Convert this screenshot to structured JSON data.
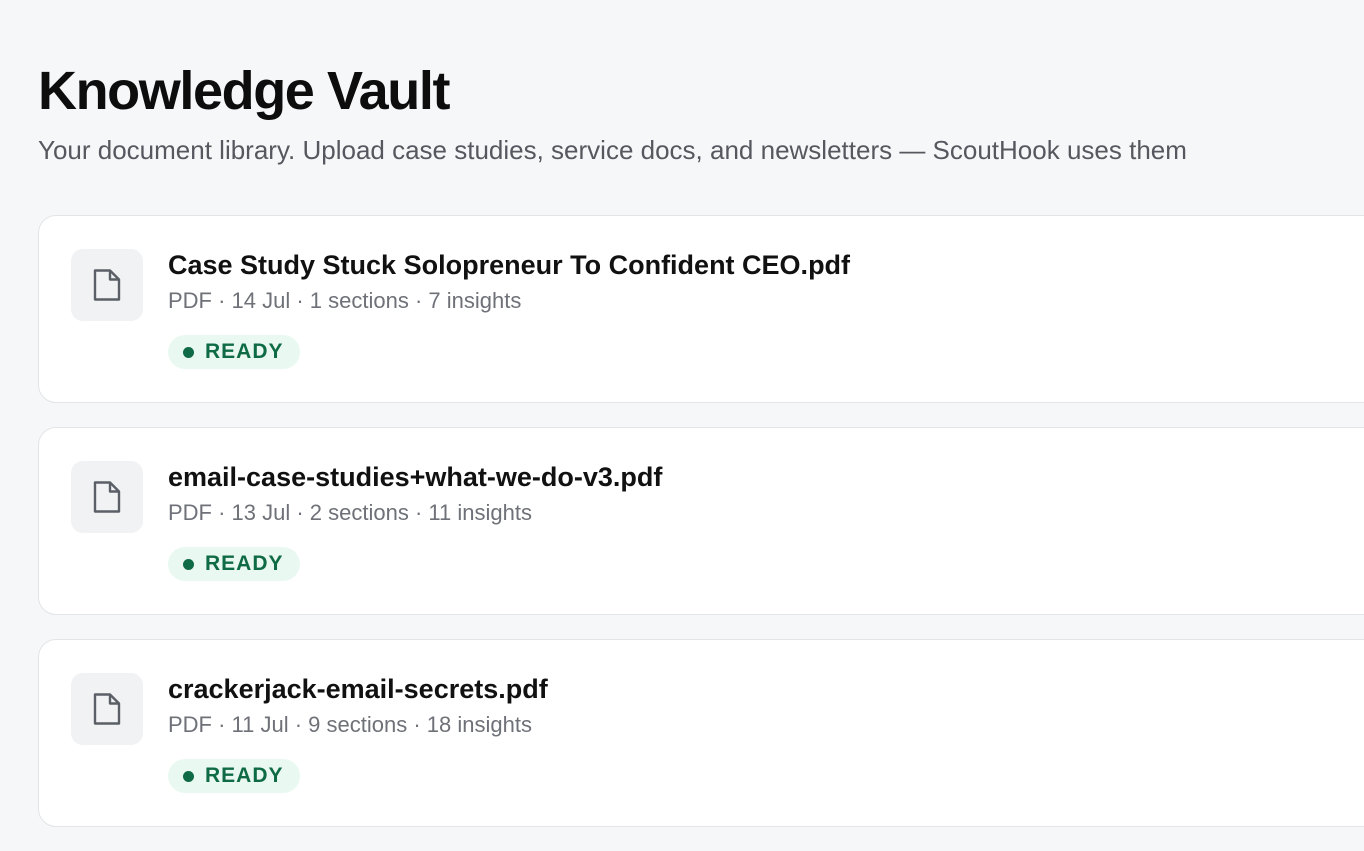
{
  "header": {
    "title": "Knowledge Vault",
    "subtitle": "Your document library. Upload case studies, service docs, and newsletters — ScoutHook uses them"
  },
  "documents": [
    {
      "name": "Case Study Stuck Solopreneur To Confident CEO.pdf",
      "meta": "PDF · 14 Jul · 1 sections · 7 insights",
      "status": "READY",
      "icon": "file-icon"
    },
    {
      "name": "email-case-studies+what-we-do-v3.pdf",
      "meta": "PDF · 13 Jul · 2 sections · 11 insights",
      "status": "READY",
      "icon": "file-icon"
    },
    {
      "name": "crackerjack-email-secrets.pdf",
      "meta": "PDF · 11 Jul · 9 sections · 18 insights",
      "status": "READY",
      "icon": "file-icon"
    }
  ],
  "colors": {
    "background": "#f6f7f9",
    "card": "#ffffff",
    "status_ready_text": "#0f6b45",
    "status_ready_bg": "#e9f8f0"
  }
}
